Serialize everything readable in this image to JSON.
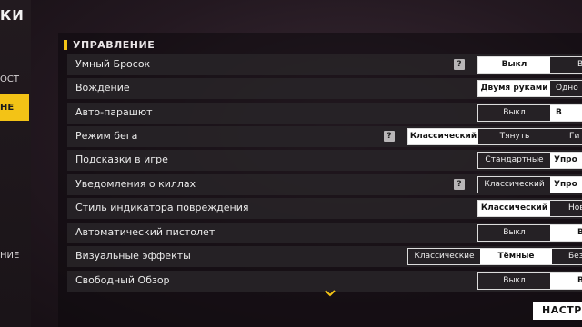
{
  "sidebar": {
    "title_fragment": "КИ",
    "items": [
      {
        "label": "ОСТ"
      },
      {
        "label": "НЕ"
      },
      {
        "label": "НИЕ"
      }
    ]
  },
  "section": {
    "title": "УПРАВЛЕНИЕ"
  },
  "rows": [
    {
      "label": "Умный Бросок",
      "help": "?",
      "options": [
        "Выкл",
        "В"
      ]
    },
    {
      "label": "Вождение",
      "options": [
        "Двумя руками",
        "Одно"
      ]
    },
    {
      "label": "Авто-парашют",
      "options": [
        "Выкл",
        "В"
      ]
    },
    {
      "label": "Режим бега",
      "help": "?",
      "options": [
        "Классический",
        "Тянуть",
        "Ги"
      ]
    },
    {
      "label": "Подсказки в игре",
      "options": [
        "Стандартные",
        "Упро"
      ]
    },
    {
      "label": "Уведомления о киллах",
      "help": "?",
      "options": [
        "Классический",
        "Упро"
      ]
    },
    {
      "label": "Стиль индикатора повреждения",
      "options": [
        "Классический",
        "Нов"
      ]
    },
    {
      "label": "Автоматический пистолет",
      "options": [
        "Выкл",
        "В"
      ]
    },
    {
      "label": "Визуальные эффекты",
      "options": [
        "Классические",
        "Тёмные",
        "Без"
      ]
    },
    {
      "label": "Свободный Обзор",
      "options": [
        "Выкл",
        "В"
      ]
    }
  ],
  "selected": [
    1,
    0,
    1,
    0,
    1,
    1,
    0,
    1,
    1,
    1
  ],
  "icons": {
    "scroll_more": "chevron-down-icon",
    "help": "question-icon"
  },
  "colors": {
    "accent": "#f3c316",
    "selected_bg": "#ffffff"
  },
  "footer": {
    "setup_button": "НАСТРО"
  }
}
